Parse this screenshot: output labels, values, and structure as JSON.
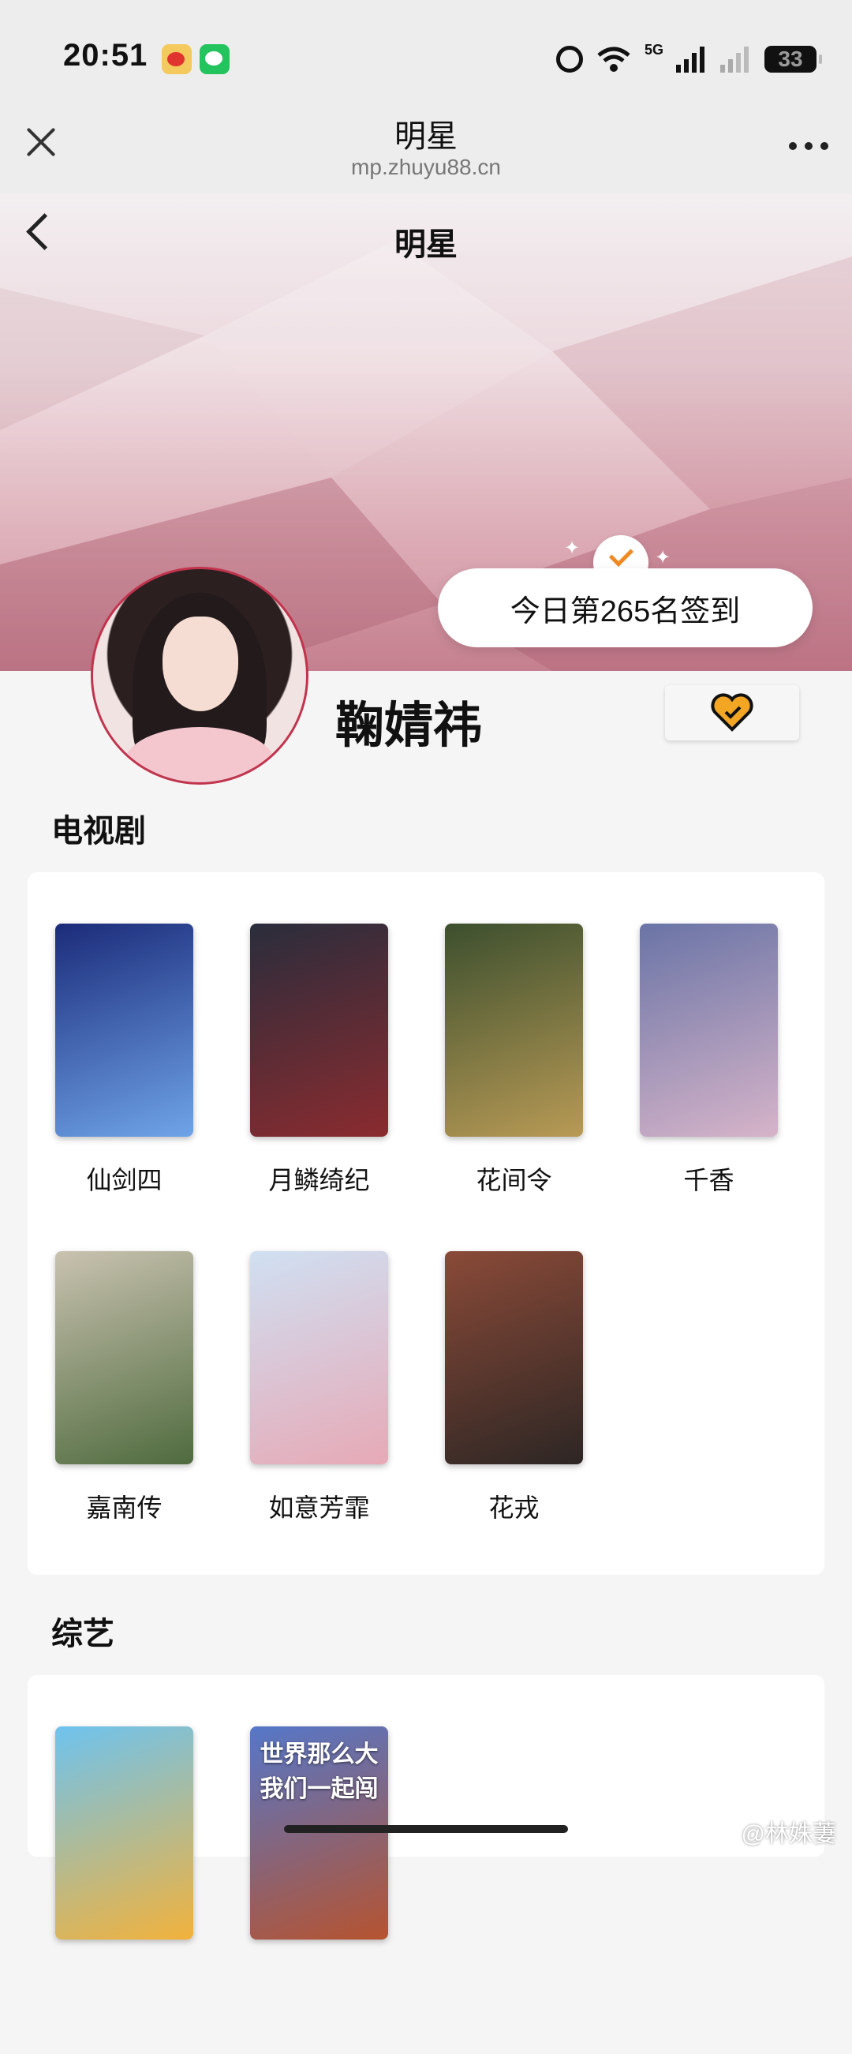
{
  "status_bar": {
    "time": "20:51",
    "network": "5G",
    "battery": "33"
  },
  "title_bar": {
    "title": "明星",
    "url": "mp.zhuyu88.cn"
  },
  "page": {
    "title": "明星"
  },
  "signin": {
    "text": "今日第265名签到"
  },
  "star": {
    "name": "鞠婧祎"
  },
  "sections": {
    "tv": {
      "title": "电视剧",
      "items": [
        {
          "label": "仙剑四",
          "color_a": "#1b2b7a",
          "color_b": "#6fa4e8"
        },
        {
          "label": "月鳞绮纪",
          "color_a": "#2a2d3c",
          "color_b": "#8a2b2f"
        },
        {
          "label": "花间令",
          "color_a": "#3c4f2e",
          "color_b": "#b89a55"
        },
        {
          "label": "千香",
          "color_a": "#6a74a6",
          "color_b": "#d6b4c9"
        },
        {
          "label": "嘉南传",
          "color_a": "#c9c2b0",
          "color_b": "#4f6b3e"
        },
        {
          "label": "如意芳霏",
          "color_a": "#cfe0f2",
          "color_b": "#e7a9b6"
        },
        {
          "label": "花戎",
          "color_a": "#8a4a38",
          "color_b": "#2d2624"
        }
      ]
    },
    "variety": {
      "title": "综艺",
      "items": [
        {
          "label": "",
          "color_a": "#6ec3ef",
          "color_b": "#f2b23c"
        },
        {
          "label": "",
          "color_a": "#5577c9",
          "color_b": "#b6532f",
          "poster_text": "世界那么大 我们一起闯"
        }
      ]
    }
  },
  "watermark": "@林姝萋"
}
